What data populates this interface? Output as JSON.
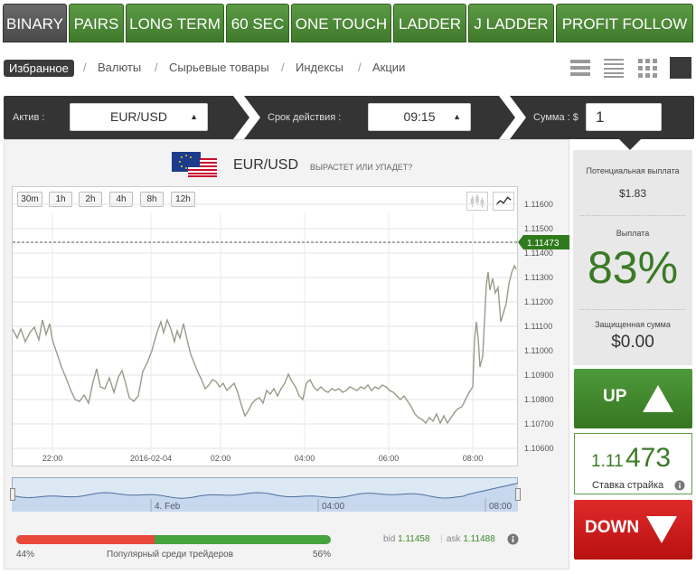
{
  "tabs": [
    "BINARY",
    "PAIRS",
    "LONG TERM",
    "60 SEC",
    "ONE TOUCH",
    "LADDER",
    "J LADDER",
    "PROFIT FOLLOW"
  ],
  "subnav": [
    "Избранное",
    "Валюты",
    "Сырьевые товары",
    "Индексы",
    "Акции"
  ],
  "controls": {
    "asset_label": "Актив :",
    "asset_value": "EUR/USD",
    "expiry_label": "Срок действия :",
    "expiry_value": "09:15",
    "amount_label": "Сумма : $",
    "amount_value": "1"
  },
  "asset": {
    "title": "EUR/USD",
    "subtitle": "ВЫРАСТЕТ ИЛИ УПАДЕТ?"
  },
  "timeframes": [
    "30m",
    "1h",
    "2h",
    "4h",
    "8h",
    "12h"
  ],
  "chart": {
    "price_tag": "1.11473",
    "y_ticks": [
      "1.11600",
      "1.11500",
      "1.11400",
      "1.11300",
      "1.11200",
      "1.11100",
      "1.11000",
      "1.10900",
      "1.10800",
      "1.10700",
      "1.10600"
    ],
    "x_ticks": [
      "22:00",
      "2016-02-04",
      "02:00",
      "04:00",
      "06:00",
      "08:00"
    ],
    "mini_labels": [
      "4. Feb",
      "04:00",
      "08:00"
    ]
  },
  "popularity": {
    "left": "44%",
    "label": "Популярный среди трейдеров",
    "right": "56%",
    "fraction_red": 0.44
  },
  "quotes": {
    "bid_label": "bid",
    "bid": "1.11458",
    "ask_label": "ask",
    "ask": "1.11488"
  },
  "right": {
    "potential_label": "Потенциальная выплата",
    "potential_value": "$1.83",
    "payout_label": "Выплата",
    "payout_value": "83%",
    "protected_label": "Защищенная сумма",
    "protected_value": "$0.00",
    "up_label": "UP",
    "down_label": "DOWN",
    "strike_prefix": "1.11",
    "strike_suffix": "473",
    "strike_label": "Ставка страйка"
  },
  "colors": {
    "green": "#3f7a2b",
    "red": "#c91717",
    "dark": "#343434"
  }
}
